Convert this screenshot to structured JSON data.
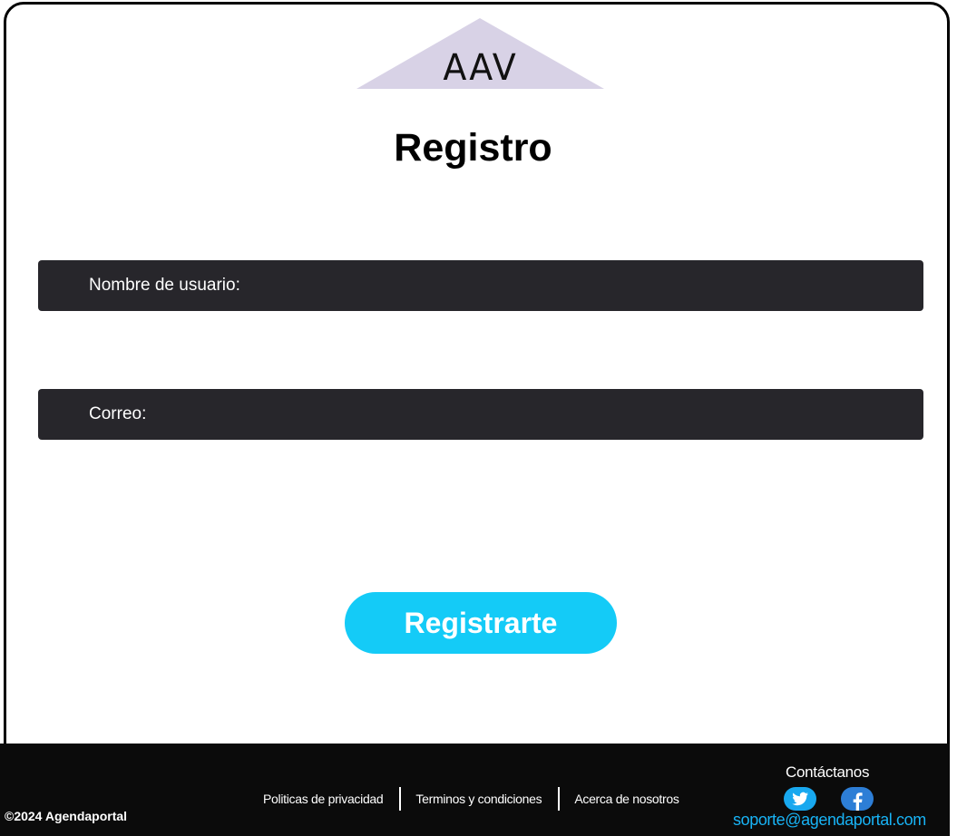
{
  "logo": {
    "text": "AAV",
    "color": "#d8d2e6"
  },
  "page": {
    "title": "Registro"
  },
  "form": {
    "username_label": "Nombre de usuario:",
    "username_value": "",
    "email_label": "Correo:",
    "email_value": "",
    "submit_label": "Registrarte",
    "field_color": "#27262b",
    "accent": "#14cbf7"
  },
  "footer": {
    "copyright": "©2024 Agendaportal",
    "links": [
      "Politicas de privacidad",
      "Terminos y condiciones",
      "Acerca de nosotros"
    ],
    "contact_title": "Contáctanos",
    "social": [
      "twitter-icon",
      "facebook-icon"
    ],
    "email": "soporte@agendaportal.com",
    "email_color": "#18b3f5"
  }
}
